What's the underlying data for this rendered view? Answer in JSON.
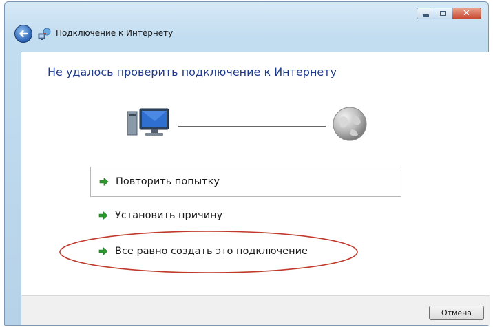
{
  "window": {
    "title": "Подключение к Интернету",
    "controls": [
      "minimize",
      "maximize",
      "close"
    ]
  },
  "main": {
    "headline": "Не удалось проверить подключение к Интернету",
    "options": [
      {
        "label": "Повторить попытку",
        "icon": "green-arrow-icon",
        "focused": true
      },
      {
        "label": "Установить причину",
        "icon": "green-arrow-icon",
        "focused": false
      },
      {
        "label": "Все равно создать это подключение",
        "icon": "green-arrow-icon",
        "highlighted": true
      }
    ]
  },
  "footer": {
    "cancel_label": "Отмена"
  },
  "colors": {
    "headline": "#1e3a8a",
    "highlight_ellipse": "#c0392b",
    "arrow": "#2e9a2e"
  }
}
